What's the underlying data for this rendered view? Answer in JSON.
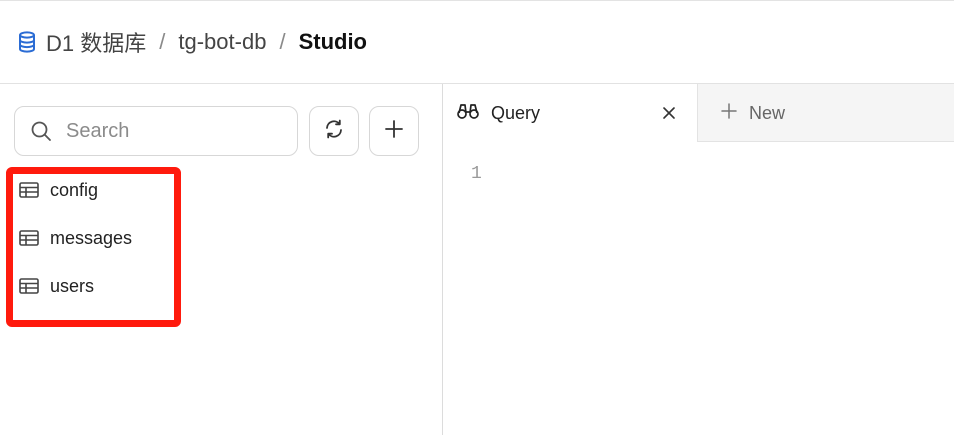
{
  "breadcrumb": {
    "items": [
      {
        "label": "D1 数据库"
      },
      {
        "label": "tg-bot-db"
      },
      {
        "label": "Studio"
      }
    ],
    "separator": "/"
  },
  "sidebar": {
    "search": {
      "placeholder": "Search",
      "value": ""
    },
    "tables": [
      {
        "label": "config"
      },
      {
        "label": "messages"
      },
      {
        "label": "users"
      }
    ]
  },
  "tabs": {
    "query": {
      "label": "Query"
    },
    "new": {
      "label": "New"
    }
  },
  "editor": {
    "line_numbers": [
      "1"
    ]
  },
  "colors": {
    "highlight": "#ff1a0d",
    "database_icon": "#2b6cd4"
  },
  "icons": [
    "database-icon",
    "search-icon",
    "refresh-icon",
    "plus-icon",
    "table-icon",
    "binoculars-icon",
    "close-icon"
  ]
}
